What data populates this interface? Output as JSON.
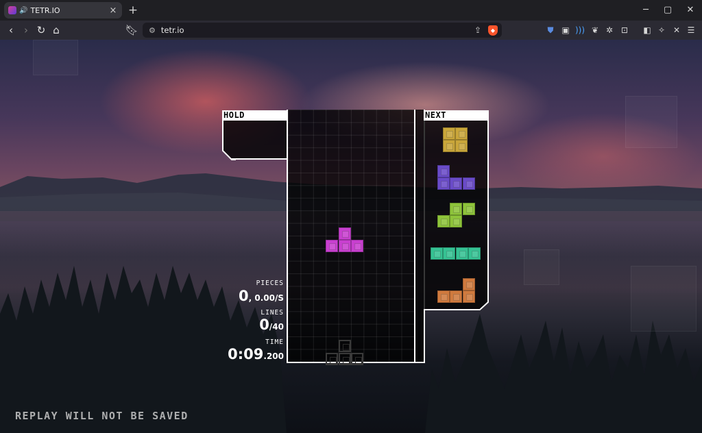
{
  "browser": {
    "tab_title": "TETR.IO",
    "tab_close": "×",
    "new_tab": "+",
    "url": "tetr.io",
    "window_controls": {
      "minimize": "─",
      "maximize": "▢",
      "close": "✕"
    }
  },
  "game": {
    "hold_label": "HOLD",
    "next_label": "NEXT",
    "stats": {
      "pieces_label": "PIECES",
      "pieces_value": "0",
      "pieces_rate": ", 0.00/S",
      "lines_label": "LINES",
      "lines_value": "0",
      "lines_goal": "/40",
      "time_label": "TIME",
      "time_main": "0:09",
      "time_ms": ".200"
    },
    "replay_note": "REPLAY WILL NOT BE SAVED",
    "board": {
      "columns": 10,
      "rows": 20
    },
    "active_piece": {
      "type": "T",
      "color": "#c93fd0"
    },
    "ghost_piece": {
      "type": "T",
      "color": "#3a3a3a"
    },
    "hold_piece": null,
    "next_queue": [
      {
        "type": "O",
        "color": "#c9a63a"
      },
      {
        "type": "J",
        "color": "#6a4bc9"
      },
      {
        "type": "S",
        "color": "#8ec43a"
      },
      {
        "type": "I",
        "color": "#35c293"
      },
      {
        "type": "L",
        "color": "#d07a3e"
      }
    ]
  }
}
